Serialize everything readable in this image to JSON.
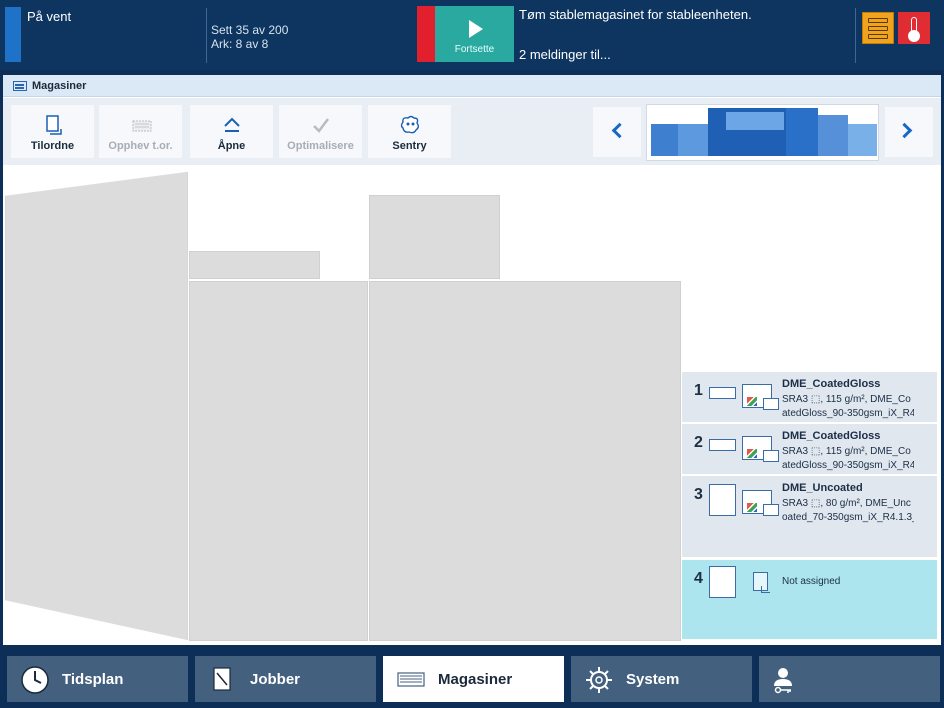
{
  "status": {
    "state": "På vent",
    "progress_sheets_line": "Sett 35 av 200",
    "progress_pages_line": "Ark: 8 av 8",
    "continue_label": "Fortsette",
    "message": "Tøm stablemagasinet for stableenheten.",
    "more_messages": "2 meldinger til...",
    "colors": {
      "bar": "#0d3560",
      "alert": "#e2202d",
      "continue": "#2aa9a1",
      "stack_warning": "#f0a31f"
    },
    "icons": [
      "stack-warning-icon",
      "temperature-icon"
    ]
  },
  "breadcrumb": {
    "label": "Magasiner",
    "icon": "trays-icon"
  },
  "toolbar": {
    "buttons": [
      {
        "label": "Tilordne",
        "icon": "assign-icon",
        "enabled": true
      },
      {
        "label": "Opphev t.or.",
        "icon": "unassign-icon",
        "enabled": false
      },
      {
        "label": "Åpne",
        "icon": "eject-icon",
        "enabled": true
      },
      {
        "label": "Optimalisere",
        "icon": "optimize-icon",
        "enabled": false
      },
      {
        "label": "Sentry",
        "icon": "sentry-icon",
        "enabled": true
      }
    ]
  },
  "trays": [
    {
      "number": "1",
      "name": "DME_CoatedGloss",
      "desc_line1": "SRA3 ⬚, 115 g/m², DME_Co",
      "desc_line2": "atedGloss_90-350gsm_iX_R4."
    },
    {
      "number": "2",
      "name": "DME_CoatedGloss",
      "desc_line1": "SRA3 ⬚, 115 g/m², DME_Co",
      "desc_line2": "atedGloss_90-350gsm_iX_R4."
    },
    {
      "number": "3",
      "name": "DME_Uncoated",
      "desc_line1": "SRA3 ⬚, 80 g/m², DME_Unc",
      "desc_line2": "oated_70-350gsm_iX_R4.1.3_"
    },
    {
      "number": "4",
      "name": "",
      "status": "Not assigned"
    }
  ],
  "bottom_nav": [
    {
      "label": "Tidsplan",
      "icon": "clock-icon",
      "active": false
    },
    {
      "label": "Jobber",
      "icon": "jobs-icon",
      "active": false
    },
    {
      "label": "Magasiner",
      "icon": "trays-icon",
      "active": true
    },
    {
      "label": "System",
      "icon": "gear-icon",
      "active": false
    },
    {
      "label": "",
      "icon": "user-key-icon",
      "active": false
    }
  ]
}
